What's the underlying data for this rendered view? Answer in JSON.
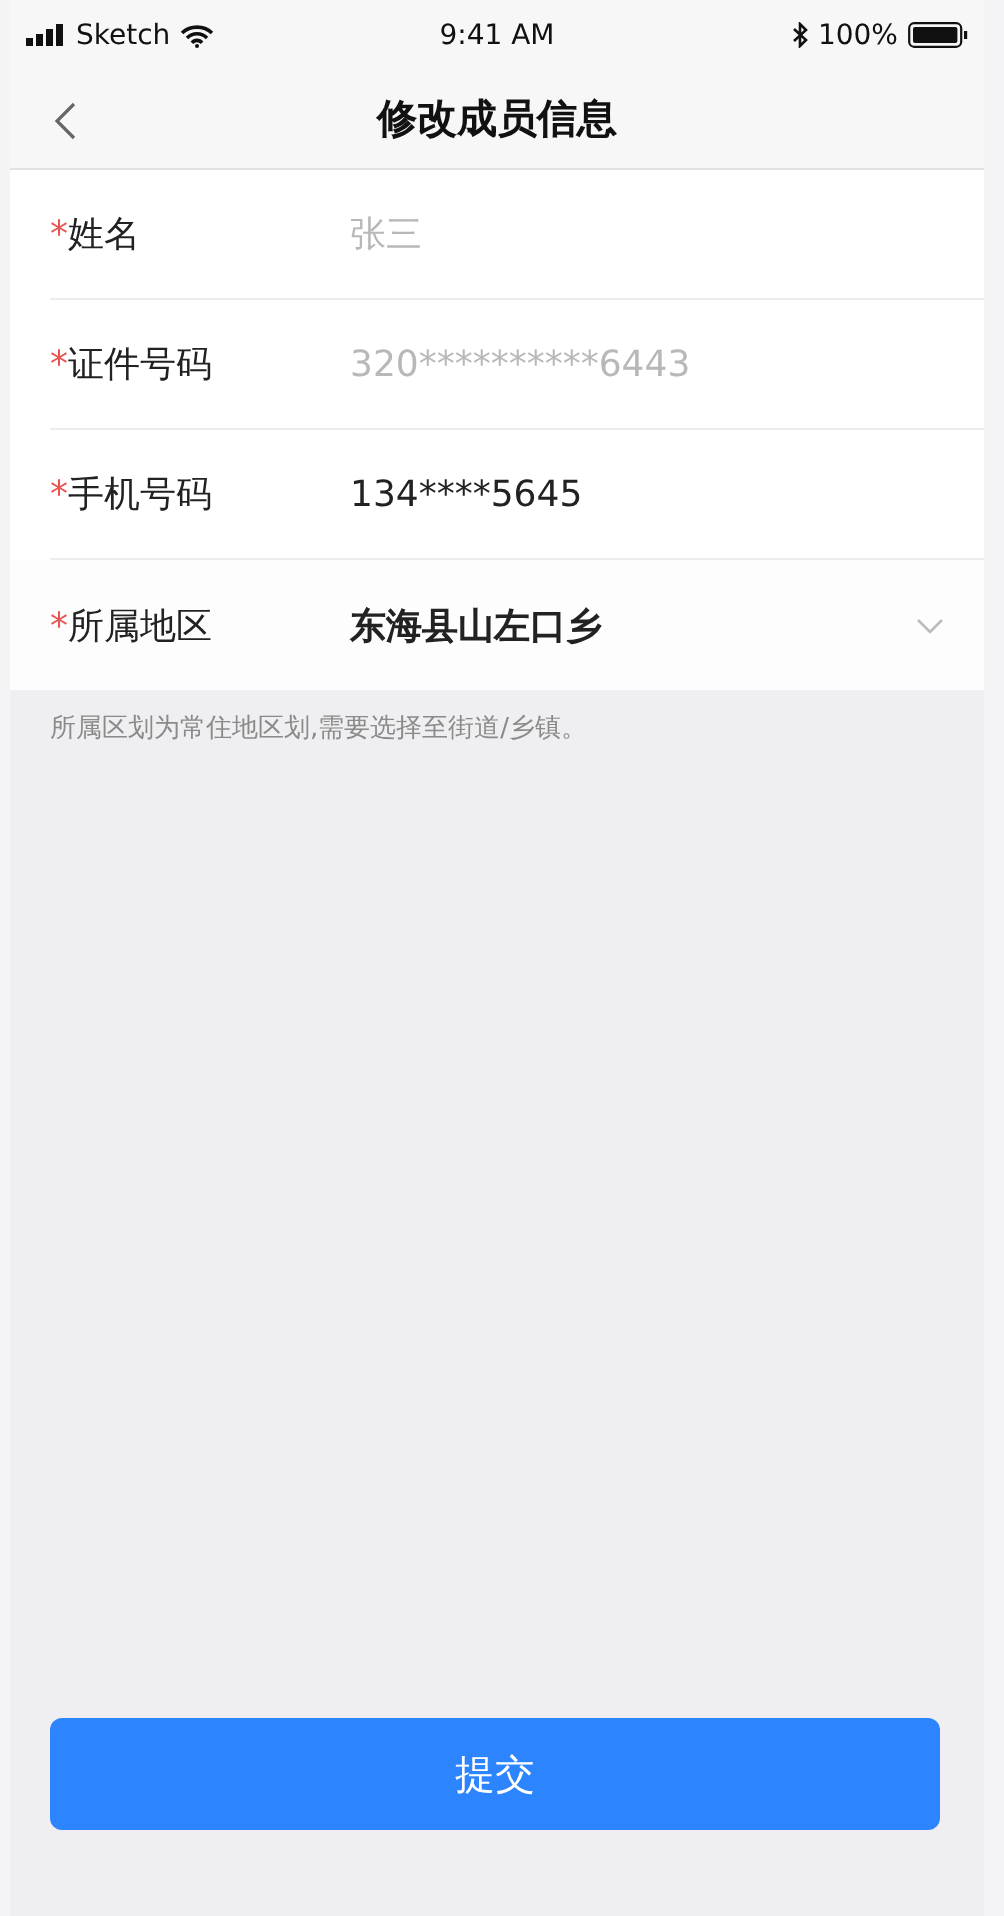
{
  "status_bar": {
    "carrier": "Sketch",
    "time": "9:41 AM",
    "battery": "100%"
  },
  "nav": {
    "title": "修改成员信息"
  },
  "fields": [
    {
      "kind": "text",
      "required": true,
      "required_mark": "*",
      "label": "姓名",
      "value": "张三",
      "disabled": true
    },
    {
      "kind": "text",
      "required": true,
      "required_mark": "*",
      "label": "证件号码",
      "value": "320**********6443",
      "disabled": true
    },
    {
      "kind": "text",
      "required": true,
      "required_mark": "*",
      "label": "手机号码",
      "value": "134****5645",
      "disabled": false
    },
    {
      "kind": "select",
      "required": true,
      "required_mark": "*",
      "label": "所属地区",
      "value": "东海县山左口乡",
      "disabled": false
    }
  ],
  "hint": "所属区划为常住地区划,需要选择至街道/乡镇。",
  "submit_button": {
    "label": "提交"
  }
}
